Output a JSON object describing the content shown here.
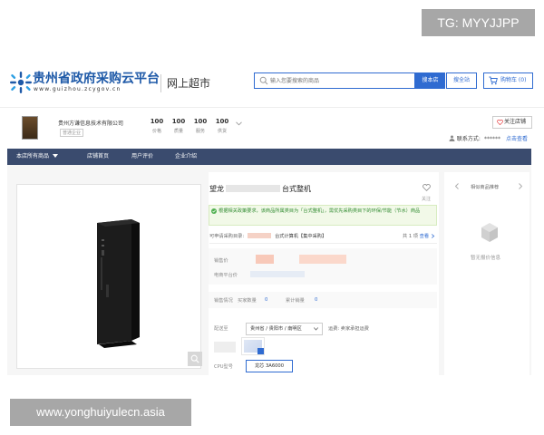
{
  "overlay": {
    "tg_badge": "TG: MYYJJPP",
    "watermark": "www.yonghuiyulecn.asia"
  },
  "colors": {
    "brand_blue": "#2f6bd1",
    "nav_bg": "#3a4b6e",
    "notice_green": "#2f8a2f"
  },
  "header": {
    "site_name": "贵州省政府采购云平台",
    "site_url": "www.guizhou.zcygov.cn",
    "section": "网上超市",
    "search": {
      "placeholder": "输入您要搜索的商品",
      "icon": "search-icon",
      "search_store_label": "搜本店",
      "search_all_label": "搜全站"
    },
    "cart_label": "购物车 (0)",
    "cart_icon": "cart-icon"
  },
  "store": {
    "name": "贵州方谦信息技术有限公司",
    "tag": "普通企业",
    "stats": [
      {
        "value": "100",
        "label": "价格"
      },
      {
        "value": "100",
        "label": "质量"
      },
      {
        "value": "100",
        "label": "服务"
      },
      {
        "value": "100",
        "label": "供货"
      }
    ],
    "follow_label": "关注店铺",
    "contact_label": "联系方式:",
    "contact_masked": "******",
    "contact_link": "点击查看"
  },
  "nav": {
    "items": [
      {
        "label": "本店所有商品"
      },
      {
        "label": "店铺首页"
      },
      {
        "label": "用户评价"
      },
      {
        "label": "企业介绍"
      }
    ]
  },
  "product": {
    "title_prefix": "望龙",
    "title_suffix": "台式整机",
    "favorite_label": "关注",
    "notice": "根据相关政策要求，该商品所属类目为「台式整机」，需优先采购类目下的环保/节能（节水）商品",
    "directory_label": "可申请采购目录:",
    "directory_category": "台式计算机【集中采购】",
    "count_text": "共 1 项",
    "count_link": "查看",
    "sale_price_label": "销售价",
    "platform_price_label": "电商平台价",
    "sales_label": "销售情况",
    "buyers_label": "买家数量",
    "buyers_value": "0",
    "cumulative_label": "累计销量",
    "cumulative_value": "0",
    "ship_label": "配送至",
    "ship_value": "贵州省 / 贵阳市 / 南明区",
    "ship_note": "运费: 卖家承担运费",
    "cpu_label": "CPU型号",
    "cpu_value": "龙芯 3A6000"
  },
  "aside": {
    "title": "相似商品推荐",
    "empty_text": "暂无报价信息"
  }
}
